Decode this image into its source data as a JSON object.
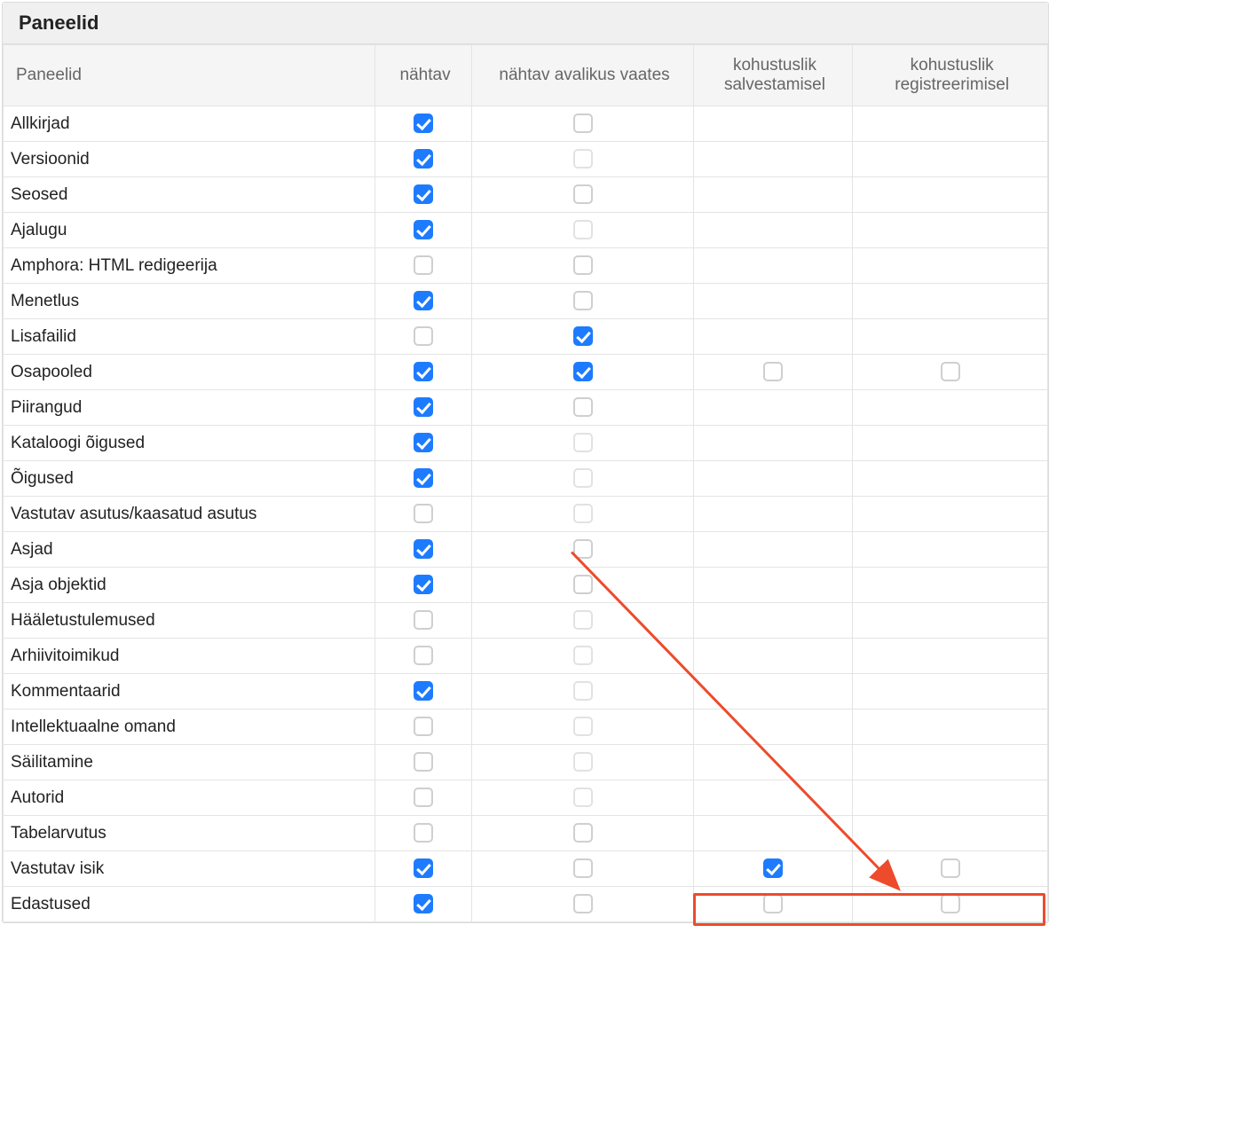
{
  "panel_title": "Paneelid",
  "columns": {
    "label": "Paneelid",
    "visible": "nähtav",
    "public_view": "nähtav avalikus vaates",
    "required_save": "kohustuslik salvestamisel",
    "required_register": "kohustuslik registreerimisel"
  },
  "rows": [
    {
      "label": "Allkirjad",
      "visible": "checked",
      "public": "unchecked",
      "save": null,
      "reg": null
    },
    {
      "label": "Versioonid",
      "visible": "checked",
      "public": "unchecked_faded",
      "save": null,
      "reg": null
    },
    {
      "label": "Seosed",
      "visible": "checked",
      "public": "unchecked",
      "save": null,
      "reg": null
    },
    {
      "label": "Ajalugu",
      "visible": "checked",
      "public": "unchecked_faded",
      "save": null,
      "reg": null
    },
    {
      "label": "Amphora: HTML redigeerija",
      "visible": "unchecked",
      "public": "unchecked",
      "save": null,
      "reg": null
    },
    {
      "label": "Menetlus",
      "visible": "checked",
      "public": "unchecked",
      "save": null,
      "reg": null
    },
    {
      "label": "Lisafailid",
      "visible": "unchecked",
      "public": "checked",
      "save": null,
      "reg": null
    },
    {
      "label": "Osapooled",
      "visible": "checked",
      "public": "checked",
      "save": "unchecked",
      "reg": "unchecked"
    },
    {
      "label": "Piirangud",
      "visible": "checked",
      "public": "unchecked",
      "save": null,
      "reg": null
    },
    {
      "label": "Kataloogi õigused",
      "visible": "checked",
      "public": "unchecked_faded",
      "save": null,
      "reg": null
    },
    {
      "label": "Õigused",
      "visible": "checked",
      "public": "unchecked_faded",
      "save": null,
      "reg": null
    },
    {
      "label": "Vastutav asutus/kaasatud asutus",
      "visible": "unchecked",
      "public": "unchecked_faded",
      "save": null,
      "reg": null
    },
    {
      "label": "Asjad",
      "visible": "checked",
      "public": "unchecked",
      "save": null,
      "reg": null
    },
    {
      "label": "Asja objektid",
      "visible": "checked",
      "public": "unchecked",
      "save": null,
      "reg": null
    },
    {
      "label": "Hääletustulemused",
      "visible": "unchecked",
      "public": "unchecked_faded",
      "save": null,
      "reg": null
    },
    {
      "label": "Arhiivitoimikud",
      "visible": "unchecked",
      "public": "unchecked_faded",
      "save": null,
      "reg": null
    },
    {
      "label": "Kommentaarid",
      "visible": "checked",
      "public": "unchecked_faded",
      "save": null,
      "reg": null
    },
    {
      "label": "Intellektuaalne omand",
      "visible": "unchecked",
      "public": "unchecked_faded",
      "save": null,
      "reg": null
    },
    {
      "label": "Säilitamine",
      "visible": "unchecked",
      "public": "unchecked_faded",
      "save": null,
      "reg": null
    },
    {
      "label": "Autorid",
      "visible": "unchecked",
      "public": "unchecked_faded",
      "save": null,
      "reg": null
    },
    {
      "label": "Tabelarvutus",
      "visible": "unchecked",
      "public": "unchecked",
      "save": null,
      "reg": null
    },
    {
      "label": "Vastutav isik",
      "visible": "checked",
      "public": "unchecked",
      "save": "checked",
      "reg": "unchecked"
    },
    {
      "label": "Edastused",
      "visible": "checked",
      "public": "unchecked",
      "save": "unchecked",
      "reg": "unchecked"
    }
  ],
  "annotation": {
    "highlight_row_index": 21,
    "arrow": {
      "from_col": "public",
      "from_row_index": 11,
      "direction": "down-right"
    }
  },
  "colors": {
    "checkbox_checked": "#1d7bff",
    "annotation": "#ed4b2b"
  }
}
